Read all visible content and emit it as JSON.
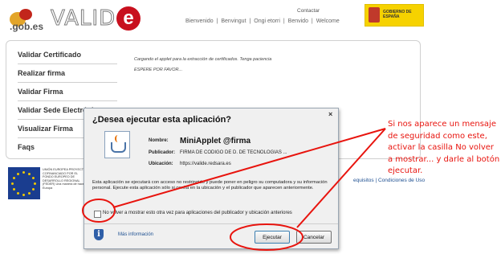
{
  "header": {
    "gobes_text": ".gob.es",
    "valide_word": "VALID",
    "valide_e": "e",
    "contact": "Contactar",
    "nav": [
      "Bienvenido",
      "Benvingut",
      "Ongi etorri",
      "Benvido",
      "Welcome"
    ],
    "nav_sep": "|",
    "gov_logo_text": "GOBIERNO DE ESPAÑA"
  },
  "sidebar": {
    "items": [
      {
        "label": "Validar Certificado"
      },
      {
        "label": "Realizar firma"
      },
      {
        "label": "Validar Firma"
      },
      {
        "label": "Validar Sede Electrónica"
      },
      {
        "label": "Visualizar Firma"
      },
      {
        "label": "Faqs"
      }
    ]
  },
  "content": {
    "loading": "Cargando el applet para la extracción de certificados. Tenga paciencia",
    "wait": "ESPERE POR FAVOR..."
  },
  "footer": {
    "eu_text": "UNIÓN EUROPEA PROYECTO COFINANCIADO POR EL FONDO EUROPEO DE DESARROLLO REGIONAL (FEDER) Una manera de hacer Europa",
    "links": "equisitos | Condiciones de Uso"
  },
  "dialog": {
    "title": "¿Desea ejecutar esta aplicación?",
    "close": "×",
    "name_label": "Nombre:",
    "name_value": "MiniApplet @firma",
    "publisher_label": "Publicador:",
    "publisher_value": "FIRMA DE CODIGO DE D. DE TECNOLOGIAS ...",
    "location_label": "Ubicación:",
    "location_value": "https://valide.redsara.es",
    "warning": "Esta aplicación se ejecutará con acceso no restringido y puede poner en peligro su computadora y su información personal. Ejecute esta aplicación sólo si confía en la ubicación y el publicador que aparecen anteriormente.",
    "checkbox_label": "No volver a mostrar esto otra vez para aplicaciones del publicador y ubicación anteriores",
    "more_info": "Más información",
    "run_button": "Ejecutar",
    "cancel_button": "Cancelar"
  },
  "annotation": {
    "text": "Si nos aparece un mensaje de seguridad como este, activar la casilla No volver a mostrar... y darle al botón ejecutar.",
    "color": "#e8140e"
  }
}
